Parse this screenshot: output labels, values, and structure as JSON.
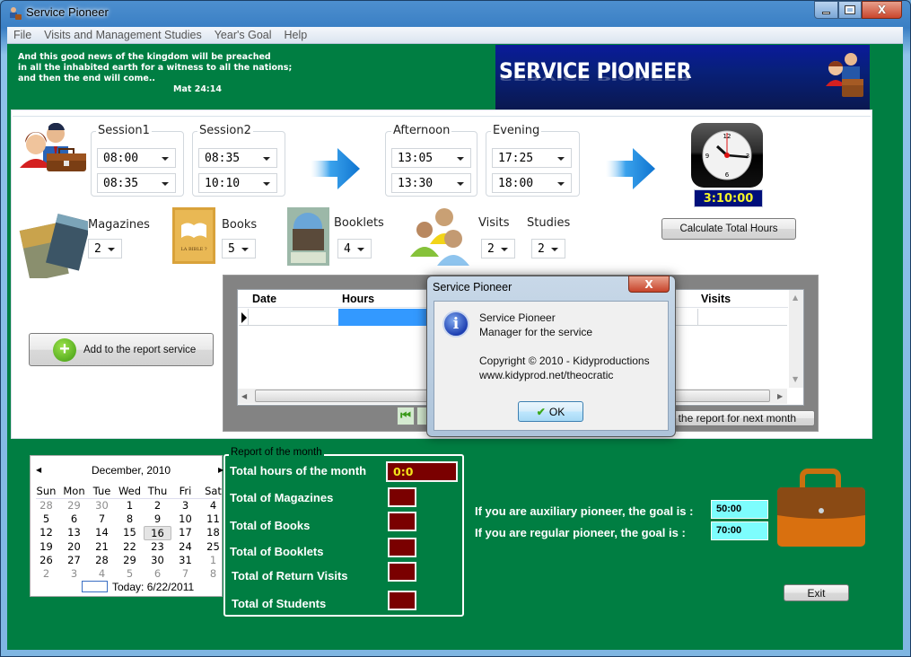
{
  "window": {
    "title": "Service Pioneer",
    "controls": {
      "minimize": "—",
      "maximize": "□",
      "close": "X"
    }
  },
  "menu": [
    "File",
    "Visits and Management Studies",
    "Year's Goal",
    "Help"
  ],
  "header": {
    "verse_lines": [
      "And this good news of the kingdom will be preached",
      "in all the inhabited earth for a witness to all the nations;",
      "and then the end will come.."
    ],
    "verse_ref": "Mat 24:14",
    "banner_title": "SERVICE PIONEER"
  },
  "sessions": [
    {
      "label": "Session1",
      "start": "08:00",
      "end": "08:35"
    },
    {
      "label": "Session2",
      "start": "08:35",
      "end": "10:10"
    },
    {
      "label": "Afternoon",
      "start": "13:05",
      "end": "13:30"
    },
    {
      "label": "Evening",
      "start": "17:25",
      "end": "18:00"
    }
  ],
  "clock": {
    "display": "3:10:00"
  },
  "calculate_button": "Calculate Total Hours",
  "counters": {
    "magazines": {
      "label": "Magazines",
      "value": "2"
    },
    "books": {
      "label": "Books",
      "value": "5"
    },
    "booklets": {
      "label": "Booklets",
      "value": "4"
    },
    "visits": {
      "label": "Visits",
      "value": "2"
    },
    "studies": {
      "label": "Studies",
      "value": "2"
    }
  },
  "add_button": "Add to the report service",
  "grid": {
    "columns": [
      "Date",
      "Hours",
      "Visits"
    ],
    "next_month_button": "the report for next month"
  },
  "dialog": {
    "title": "Service Pioneer",
    "close": "X",
    "line1": "Service Pioneer",
    "line2": "Manager for the service",
    "line3": "Copyright © 2010 - Kidyproductions",
    "line4": "www.kidyprod.net/theocratic",
    "ok": "OK"
  },
  "calendar": {
    "month": "December, 2010",
    "weekdays": [
      "Sun",
      "Mon",
      "Tue",
      "Wed",
      "Thu",
      "Fri",
      "Sat"
    ],
    "weeks": [
      [
        "28",
        "29",
        "30",
        "1",
        "2",
        "3",
        "4"
      ],
      [
        "5",
        "6",
        "7",
        "8",
        "9",
        "10",
        "11"
      ],
      [
        "12",
        "13",
        "14",
        "15",
        "16",
        "17",
        "18"
      ],
      [
        "19",
        "20",
        "21",
        "22",
        "23",
        "24",
        "25"
      ],
      [
        "26",
        "27",
        "28",
        "29",
        "30",
        "31",
        "1"
      ],
      [
        "2",
        "3",
        "4",
        "5",
        "6",
        "7",
        "8"
      ]
    ],
    "selected": "16",
    "today": "Today: 6/22/2011"
  },
  "report": {
    "legend": "Report of the month",
    "total_hours_label": "Total hours of the month",
    "total_hours_value": "0:0",
    "rows": [
      "Total of Magazines",
      "Total of Books",
      "Total of Booklets",
      "Total of Return Visits",
      "Total of Students"
    ]
  },
  "goals": {
    "auxiliary_label": "If you are auxiliary pioneer, the goal is :",
    "auxiliary_value": "50:00",
    "regular_label": "If you are regular pioneer, the goal is :",
    "regular_value": "70:00"
  },
  "exit_button": "Exit",
  "colors": {
    "client_bg": "#007e42",
    "banner_bg": "#0a1a9a",
    "report_box": "#7a0000",
    "goal_box": "#7dfdfd",
    "clock_display_bg": "#000f7a",
    "clock_display_text": "#f4f428"
  }
}
